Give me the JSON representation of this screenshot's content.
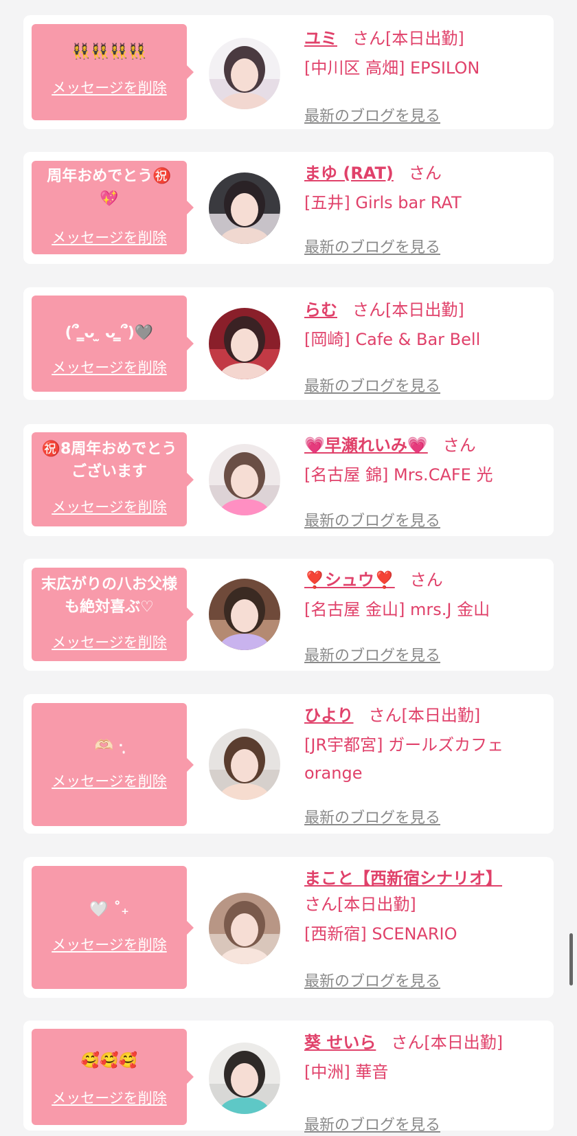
{
  "delete_label": "メッセージを削除",
  "san_label": "さん",
  "blog_label": "最新のブログを見る",
  "today_label": "[本日出勤]",
  "colors": {
    "accent": "#e0416a",
    "bubble": "#f89aaa",
    "card": "#ffffff",
    "background": "#f4f4f5",
    "link_gray": "#8a8a8a"
  },
  "items": [
    {
      "message": "👯‍♀️👯‍♀️👯‍♀️👯‍♀️",
      "name": "ユミ",
      "today": true,
      "store": "[中川区 高畑] EPSILON",
      "avatar_icon": "portrait-photo"
    },
    {
      "message": "周年おめでとう㊗️\n💖",
      "name": "まゆ (RAT)",
      "today": false,
      "store": "[五井] Girls bar RAT",
      "avatar_icon": "portrait-photo"
    },
    {
      "message": "(՞ ̳ᴗ ̫ ᴗ ̳՞)🩶",
      "name": "らむ",
      "today": true,
      "store": "[岡崎] Cafe & Bar Bell",
      "avatar_icon": "portrait-photo"
    },
    {
      "message": "㊗️8周年おめでとうございます",
      "name": "💗早瀬れいみ💗",
      "today": false,
      "store": "[名古屋 錦] Mrs.CAFE 光",
      "avatar_icon": "portrait-photo"
    },
    {
      "message": "末広がりの八お父様も絶対喜ぶ♡",
      "name": "❣️シュウ❣️",
      "today": false,
      "store": "[名古屋 金山] mrs.J 金山",
      "avatar_icon": "portrait-photo"
    },
    {
      "message": "🫶🏻 ·̩͙",
      "name": "ひより",
      "today": true,
      "store": "[JR宇都宮] ガールズカフェ\norange",
      "avatar_icon": "portrait-photo"
    },
    {
      "message": "🤍 ˚₊",
      "name": "まこと【西新宿シナリオ】",
      "today": true,
      "store": "[西新宿] SCENARIO",
      "avatar_icon": "portrait-photo"
    },
    {
      "message": "🥰🥰🥰",
      "name": "葵 せいら",
      "today": true,
      "store": "[中洲] 華音",
      "avatar_icon": "portrait-photo"
    }
  ]
}
